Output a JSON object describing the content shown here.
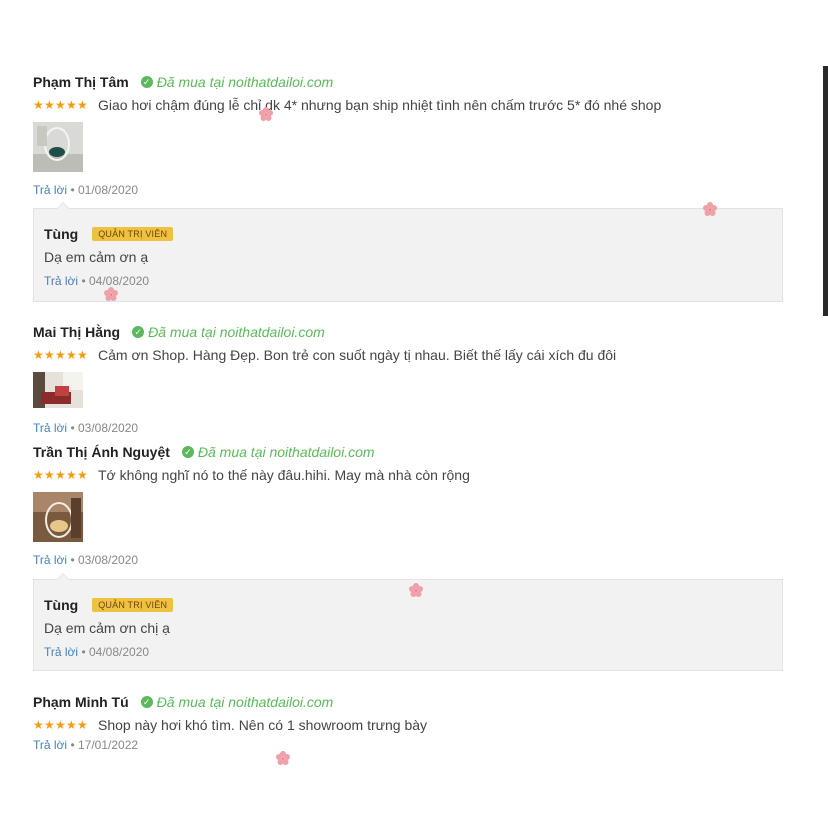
{
  "reviews": [
    {
      "name": "Phạm Thị Tâm",
      "verified": "Đã mua tại noithatdailoi.com",
      "comment": "Giao hơi chậm đúng lễ chỉ dk 4* nhưng bạn ship nhiệt tình nên chấm trước 5* đó nhé shop",
      "rating": 5,
      "has_photo": true,
      "reply_label": "Trả lời",
      "date": "01/08/2020",
      "admin_reply": {
        "name": "Tùng",
        "badge": "QUẢN TRỊ VIÊN",
        "text": "Dạ em cảm ơn ạ",
        "reply_label": "Trả lời",
        "date": "04/08/2020"
      }
    },
    {
      "name": "Mai Thị Hằng",
      "verified": "Đã mua tại noithatdailoi.com",
      "comment": "Cảm ơn Shop. Hàng Đẹp. Bon trẻ con suốt ngày tị nhau. Biết thế lấy cái xích đu đôi",
      "rating": 5,
      "has_photo": true,
      "reply_label": "Trả lời",
      "date": "03/08/2020"
    },
    {
      "name": "Trần Thị Ánh Nguyệt",
      "verified": "Đã mua tại noithatdailoi.com",
      "comment": "Tớ không nghĩ nó to thế này đâu.hihi. May mà nhà còn rộng",
      "rating": 5,
      "has_photo": true,
      "reply_label": "Trả lời",
      "date": "03/08/2020",
      "admin_reply": {
        "name": "Tùng",
        "badge": "QUẢN TRỊ VIÊN",
        "text": "Dạ em cảm ơn chị ạ",
        "reply_label": "Trả lời",
        "date": "04/08/2020"
      }
    },
    {
      "name": "Phạm Minh Tú",
      "verified": "Đã mua tại noithatdailoi.com",
      "comment": "Shop này hơi khó tìm. Nên có 1 showroom trưng bày",
      "rating": 5,
      "has_photo": false,
      "reply_label": "Trả lời",
      "date": "17/01/2022"
    }
  ],
  "separator": "•",
  "colors": {
    "verified": "#5cb85c",
    "star": "#f39c12",
    "link": "#4a7fb5",
    "badge_bg": "#f0c040",
    "admin_bg": "#f2f2f2",
    "petal": "#f0a0a8"
  }
}
